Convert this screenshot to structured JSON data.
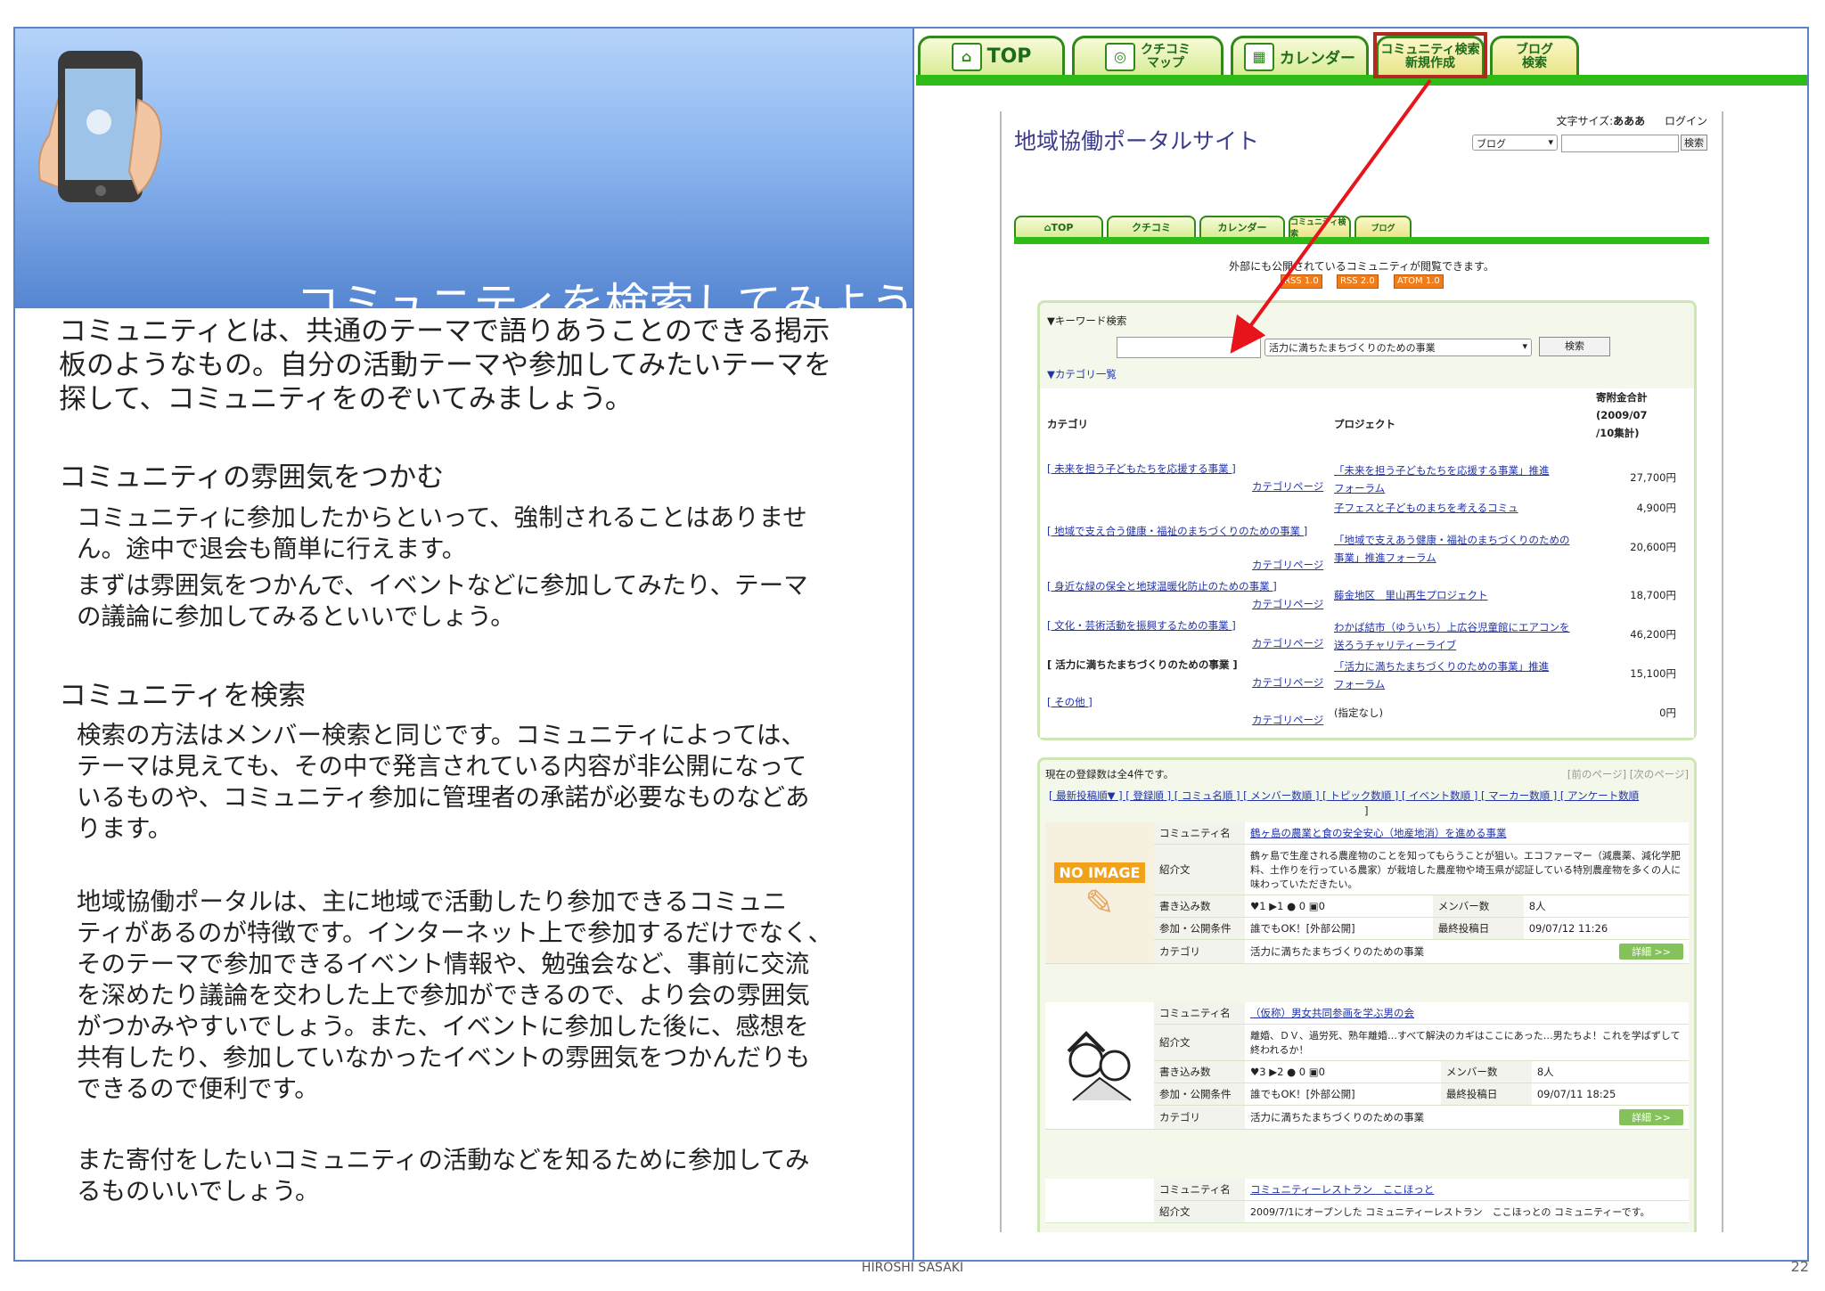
{
  "slide": {
    "title": "コミュニティを検索してみよう",
    "intro": [
      "コミュニティとは、共通のテーマで語りあうことのできる掲示",
      "板のようなもの。自分の活動テーマや参加してみたいテーマを",
      "探して、コミュニティをのぞいてみましょう。"
    ],
    "section1_heading": "コミュニティの雰囲気をつかむ",
    "section1_p1": [
      "コミュニティに参加したからといって、強制されることはありませ",
      "ん。途中で退会も簡単に行えます。"
    ],
    "section1_p2": [
      "まずは雰囲気をつかんで、イベントなどに参加してみたり、テーマ",
      "の議論に参加してみるといいでしょう。"
    ],
    "section2_heading": "コミュニティを検索",
    "section2_p1": [
      "検索の方法はメンバー検索と同じです。コミュニティによっては、",
      "テーマは見えても、その中で発言されている内容が非公開になって",
      "いるものや、コミュニティ参加に管理者の承諾が必要なものなどあ",
      "ります。"
    ],
    "section2_p2": [
      "地域協働ポータルは、主に地域で活動したり参加できるコミュニ",
      "ティがあるのが特徴です。インターネット上で参加するだけでなく、",
      "そのテーマで参加できるイベント情報や、勉強会など、事前に交流",
      "を深めたり議論を交わした上で参加ができるので、より会の雰囲気",
      "がつかみやすいでしょう。また、イベントに参加した後に、感想を",
      "共有したり、参加していなかったイベントの雰囲気をつかんだりも",
      "できるので便利です。"
    ],
    "section2_p3": [
      "また寄付をしたいコミュニティの活動などを知るために参加してみ",
      "るものいいでしょう。"
    ],
    "footer_author": "HIROSHI SASAKI",
    "page_number": "22"
  },
  "nav": {
    "top": "TOP",
    "kuchikomi": [
      "クチコミ",
      "マップ"
    ],
    "calendar": "カレンダー",
    "community": [
      "コミュニティ検索",
      "新規作成"
    ],
    "blog": [
      "ブログ",
      "検索"
    ]
  },
  "site": {
    "title": "地域協働ポータルサイト",
    "font_size_label": "文字サイズ:",
    "font_size_opts": "あああ",
    "login": "ログイン",
    "search_select": "ブログ",
    "search_button": "検索",
    "public_note": "外部にも公開されているコミュニティが閲覧できます。",
    "feeds": [
      "RSS 1.0",
      "RSS 2.0",
      "ATOM 1.0"
    ],
    "keyword_heading": "▼キーワード検索",
    "keyword_select": "活力に満ちたまちづくりのための事業",
    "keyword_button": "検索",
    "category_heading": "▼カテゴリ一覧",
    "col_category": "カテゴリ",
    "col_project": "プロジェクト",
    "col_amount": [
      "寄附金合計",
      "(2009/07",
      "/10集計)"
    ],
    "category_page": "カテゴリページ",
    "categories": [
      {
        "name": "[ 未来を担う子どもたちを応援する事業 ]",
        "projects": [
          "「未来を担う子どもたちを応援する事業」推進",
          "フォーラム"
        ],
        "extra": "子フェスと子どものまちを考えるコミュ",
        "amount": "27,700円",
        "amount2": "4,900円"
      },
      {
        "name": "[ 地域で支え合う健康・福祉のまちづくりのための事業 ]",
        "projects": [
          "「地域で支えあう健康・福祉のまちづくりのための",
          "事業」推進フォーラム"
        ],
        "amount": "20,600円"
      },
      {
        "name": "[ 身近な緑の保全と地球温暖化防止のための事業 ]",
        "projects": [
          "藤金地区　里山再生プロジェクト"
        ],
        "amount": "18,700円"
      },
      {
        "name": "[ 文化・芸術活動を振興するための事業 ]",
        "projects": [
          "わかば結市（ゆういち）上広谷児童館にエアコンを",
          "送ろうチャリティーライブ"
        ],
        "amount": "46,200円"
      },
      {
        "name": "[ 活力に満ちたまちづくりのための事業 ]",
        "projects": [
          "「活力に満ちたまちづくりのための事業」推進",
          "フォーラム"
        ],
        "amount": "15,100円"
      },
      {
        "name": "[ その他 ]",
        "projects": [
          "(指定なし)"
        ],
        "amount": "0円"
      }
    ],
    "count_text": "現在の登録数は全4件です。",
    "pager": "[前のページ] [次のページ]",
    "sort_links": "[ 最新投稿順▼ ] [ 登録順 ] [ コミュ名順 ] [ メンバー数順 ] [ トピック数順 ] [ イベント数順 ] [ マーカー数順 ] [ アンケート数順",
    "sort_end": "]",
    "labels": {
      "name": "コミュニティ名",
      "intro": "紹介文",
      "posts": "書き込み数",
      "members": "メンバー数",
      "cond": "参加・公開条件",
      "last": "最終投稿日",
      "cat": "カテゴリ"
    },
    "detail": "詳細 >>",
    "no_image": "NO IMAGE",
    "communities": [
      {
        "name": "鶴ヶ島の農業と食の安全安心（地産地消）を進める事業",
        "intro": "鶴ヶ島で生産される農産物のことを知ってもらうことが狙い。エコファーマー（減農薬、減化学肥料、土作りを行っている農家）が栽培した農産物や埼玉県が認証している特別農産物を多くの人に味わっていただきたい。",
        "posts": "♥1 ▶1 ● 0 ▣0",
        "members": "8人",
        "cond": "誰でもOK！[外部公開]",
        "last": "09/07/12 11:26",
        "cat": "活力に満ちたまちづくりのための事業"
      },
      {
        "name": "（仮称）男女共同参画を学ぶ男の会",
        "intro": "離婚、ＤＶ、過労死、熟年離婚…すべて解決のカギはここにあった…男たちよ！これを学ばずして終われるか！",
        "posts": "♥3 ▶2 ● 0 ▣0",
        "members": "8人",
        "cond": "誰でもOK！[外部公開]",
        "last": "09/07/11 18:25",
        "cat": "活力に満ちたまちづくりのための事業"
      },
      {
        "name": "コミュニティーレストラン　ここほっと",
        "intro": "2009/7/1にオープンした コミュニティーレストラン　ここほっとの コミュニティーです。"
      }
    ]
  }
}
